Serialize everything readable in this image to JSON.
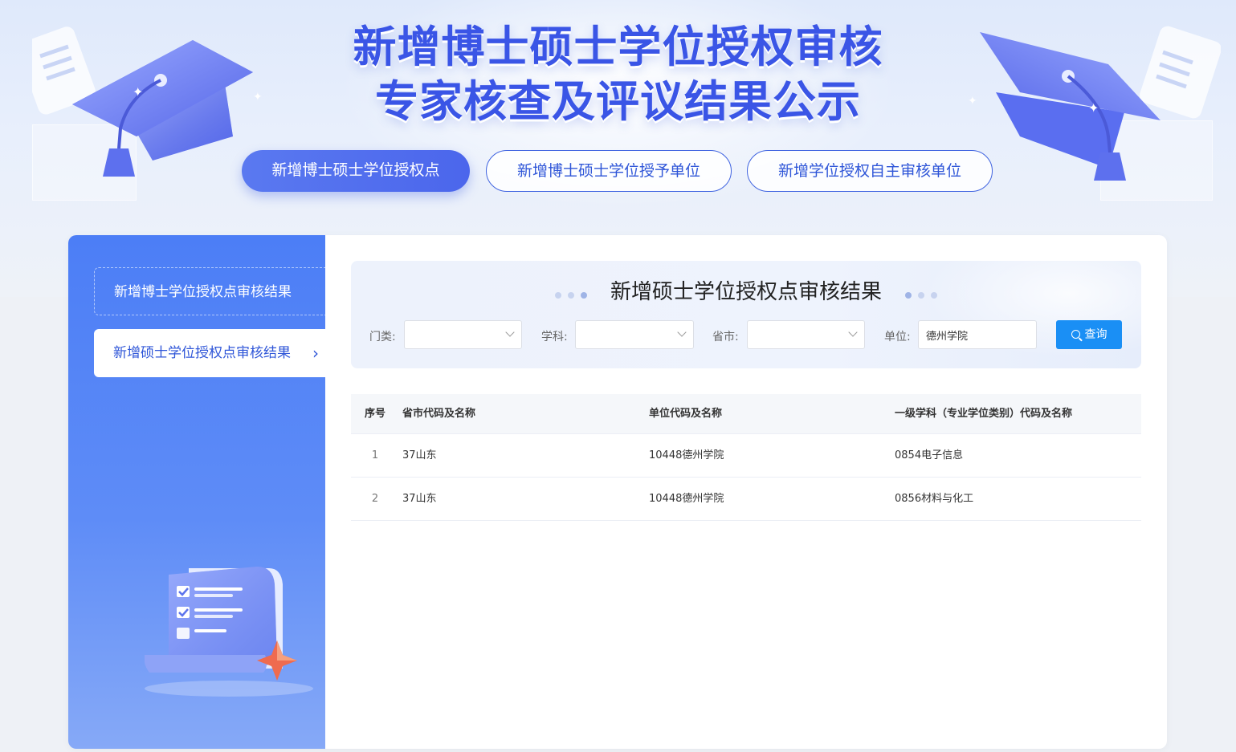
{
  "header": {
    "title_line1": "新增博士硕士学位授权审核",
    "title_line2": "专家核查及评议结果公示"
  },
  "tabs": [
    {
      "label": "新增博士硕士学位授权点",
      "active": true
    },
    {
      "label": "新增博士硕士学位授予单位",
      "active": false
    },
    {
      "label": "新增学位授权自主审核单位",
      "active": false
    }
  ],
  "sidebar": {
    "items": [
      {
        "label": "新增博士学位授权点审核结果",
        "active": false
      },
      {
        "label": "新增硕士学位授权点审核结果",
        "active": true,
        "icon": "chevron-right-icon"
      }
    ],
    "illustration": "checklist-document-icon"
  },
  "main": {
    "section_title": "新增硕士学位授权点审核结果",
    "filters": {
      "category_label": "门类:",
      "category_value": "",
      "subject_label": "学科:",
      "subject_value": "",
      "province_label": "省市:",
      "province_value": "",
      "unit_label": "单位:",
      "unit_value": "德州学院",
      "query_label": "查询",
      "query_icon": "search-icon"
    },
    "table": {
      "columns": [
        "序号",
        "省市代码及名称",
        "单位代码及名称",
        "一级学科（专业学位类别）代码及名称"
      ],
      "rows": [
        [
          "1",
          "37山东",
          "10448德州学院",
          "0854电子信息"
        ],
        [
          "2",
          "37山东",
          "10448德州学院",
          "0856材料与化工"
        ]
      ]
    }
  },
  "colors": {
    "brand_blue": "#3a55e6",
    "active_tab": "#4b66ec",
    "sidebar_top": "#4c7ef6",
    "query_button": "#1a8ff5"
  }
}
